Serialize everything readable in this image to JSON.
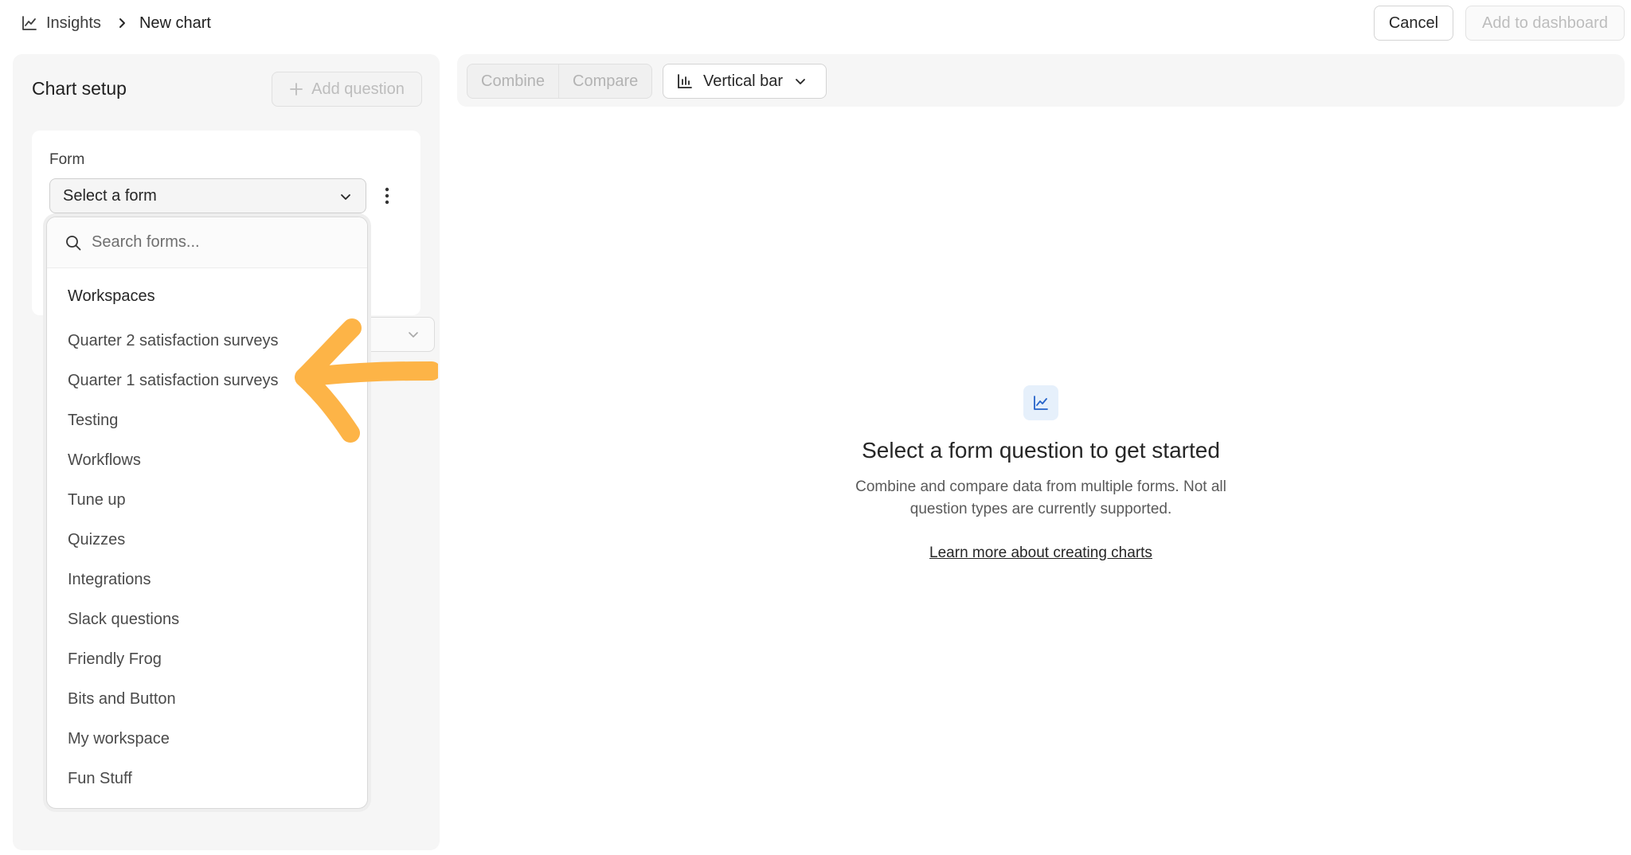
{
  "breadcrumb": {
    "root": "Insights",
    "current": "New chart"
  },
  "header": {
    "cancel_label": "Cancel",
    "add_dashboard_label": "Add to dashboard"
  },
  "chart_setup": {
    "title": "Chart setup",
    "add_question_label": "Add question",
    "form_label": "Form",
    "form_select_value": "Select a form"
  },
  "dropdown": {
    "search_placeholder": "Search forms...",
    "heading": "Workspaces",
    "items": [
      "Quarter 2 satisfaction surveys",
      "Quarter 1 satisfaction surveys",
      "Testing",
      "Workflows",
      "Tune up",
      "Quizzes",
      "Integrations",
      "Slack questions",
      "Friendly Frog",
      "Bits and Button",
      "My workspace",
      "Fun Stuff"
    ]
  },
  "toolbar": {
    "combine_label": "Combine",
    "compare_label": "Compare",
    "chart_type": "Vertical bar"
  },
  "empty_state": {
    "title": "Select a form question to get started",
    "description": "Combine and compare data from multiple forms. Not all question types are currently supported.",
    "link": "Learn more about creating charts"
  },
  "colors": {
    "arrow": "#FDB447",
    "accent_icon": "#2563c9",
    "accent_icon_bg": "#e6f0fb"
  },
  "icons": {
    "breadcrumb_root": "line-chart-icon",
    "separator": "chevron-right-icon",
    "add_question": "plus-icon",
    "form_select": "chevron-down-icon",
    "form_more": "kebab-icon",
    "search": "search-icon",
    "chart_type": "bar-chart-icon",
    "empty_state": "line-chart-icon"
  }
}
